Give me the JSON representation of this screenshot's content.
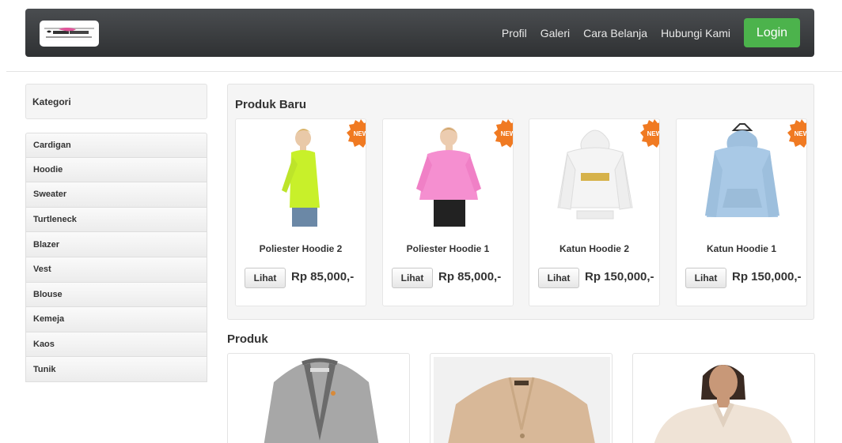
{
  "navbar": {
    "links": [
      "Profil",
      "Galeri",
      "Cara Belanja",
      "Hubungi Kami"
    ],
    "login_label": "Login"
  },
  "sidebar": {
    "title": "Kategori",
    "items": [
      "Cardigan",
      "Hoodie",
      "Sweater",
      "Turtleneck",
      "Blazer",
      "Vest",
      "Blouse",
      "Kemeja",
      "Kaos",
      "Tunik"
    ]
  },
  "new_products": {
    "title": "Produk Baru",
    "badge_label": "NEW",
    "button_label": "Lihat",
    "items": [
      {
        "name": "Poliester Hoodie 2",
        "price": "Rp 85,000,-",
        "color": "#c8f02a",
        "image": "person-lime-jacket"
      },
      {
        "name": "Poliester Hoodie 1",
        "price": "Rp 85,000,-",
        "color": "#f58fd0",
        "image": "person-pink-jacket"
      },
      {
        "name": "Katun Hoodie 2",
        "price": "Rp 150,000,-",
        "color": "#f4f4f4",
        "image": "white-hoodie"
      },
      {
        "name": "Katun Hoodie 1",
        "price": "Rp 150,000,-",
        "color": "#a9c9e6",
        "image": "blue-hoodie"
      }
    ]
  },
  "products": {
    "title": "Produk",
    "items": [
      {
        "image": "grey-cardigan",
        "color": "#a7a7a7"
      },
      {
        "image": "beige-cardigan",
        "color": "#d8b898"
      },
      {
        "image": "cream-cardigan-model",
        "color": "#efe3d6"
      }
    ]
  },
  "colors": {
    "navbar": "#3a3c3e",
    "login_button": "#4cb34c",
    "badge": "#f07a22"
  }
}
